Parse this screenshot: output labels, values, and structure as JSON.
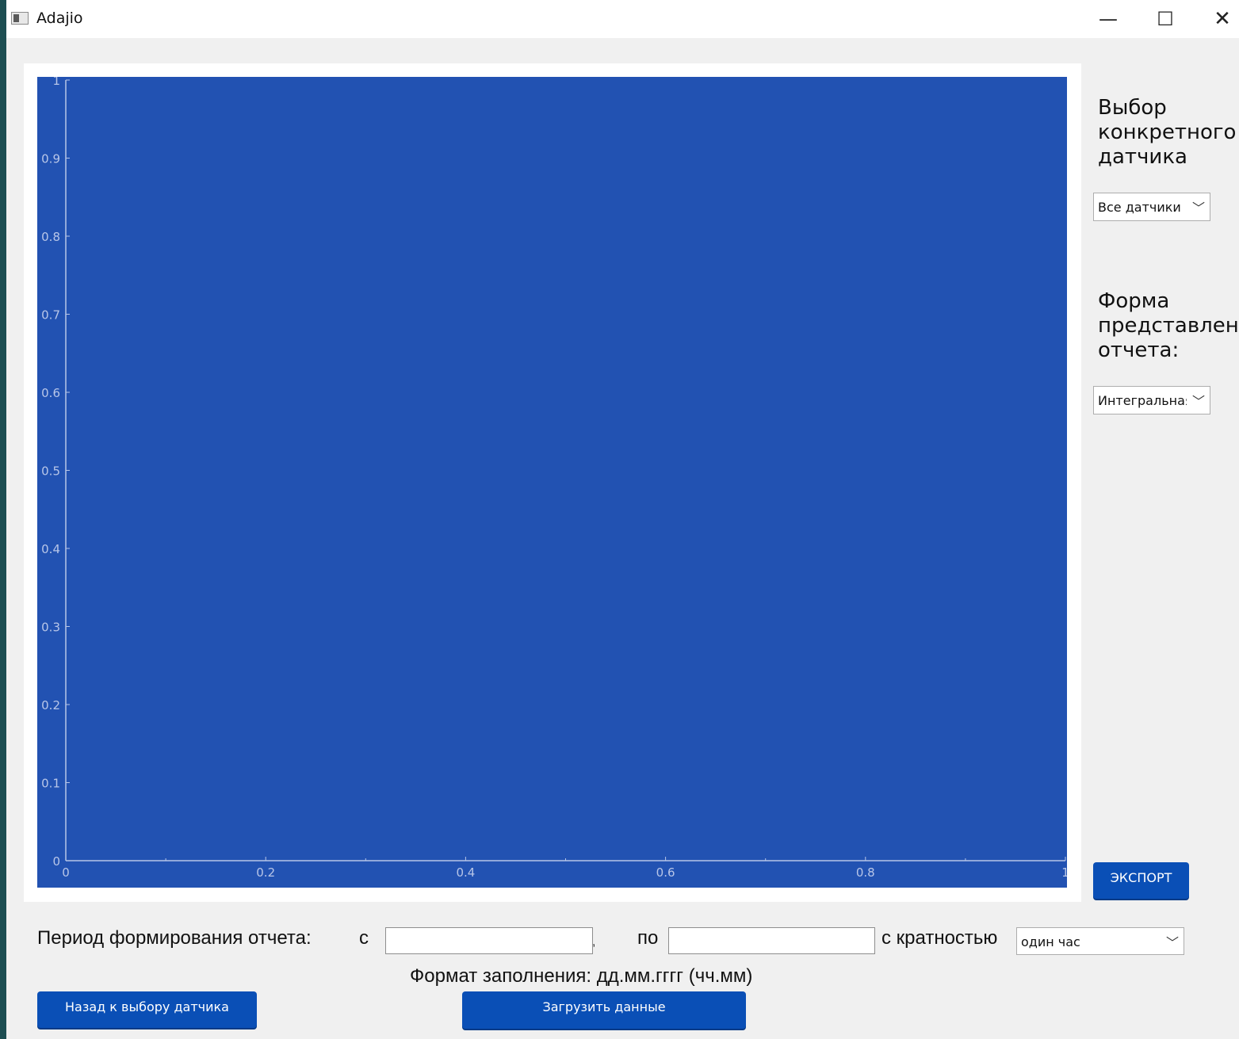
{
  "window": {
    "title": "Adajio",
    "controls": {
      "minimize": "—",
      "maximize": "☐",
      "close": "✕"
    }
  },
  "sidebar": {
    "sensor_label": "Выбор конкретного датчика",
    "sensor_select_value": "Все датчики",
    "format_label": "Форма представления отчета:",
    "format_select_value": "Интегральная",
    "export_button": "ЭКСПОРТ"
  },
  "period": {
    "label": "Период формирования отчета:",
    "from_label": "с",
    "from_value": "",
    "separator": ",",
    "to_label": "по",
    "to_value": "",
    "multiplicity_label": "с кратностью",
    "multiplicity_value": "один час",
    "format_hint": "Формат заполнения: дд.мм.гггг (чч.мм)"
  },
  "buttons": {
    "back": "Назад к выбору датчика",
    "load": "Загрузить данные"
  },
  "colors": {
    "plot_background": "#2252b2",
    "axis": "#b8c6e8",
    "button": "#0a4fb6"
  },
  "chart_data": {
    "type": "line",
    "series": [],
    "xlim": [
      0,
      1
    ],
    "ylim": [
      0,
      1
    ],
    "xticks": [
      "0",
      "0.2",
      "0.4",
      "0.6",
      "0.8",
      "1"
    ],
    "yticks": [
      "0",
      "0.1",
      "0.2",
      "0.3",
      "0.4",
      "0.5",
      "0.6",
      "0.7",
      "0.8",
      "0.9",
      "1"
    ],
    "grid": false
  }
}
